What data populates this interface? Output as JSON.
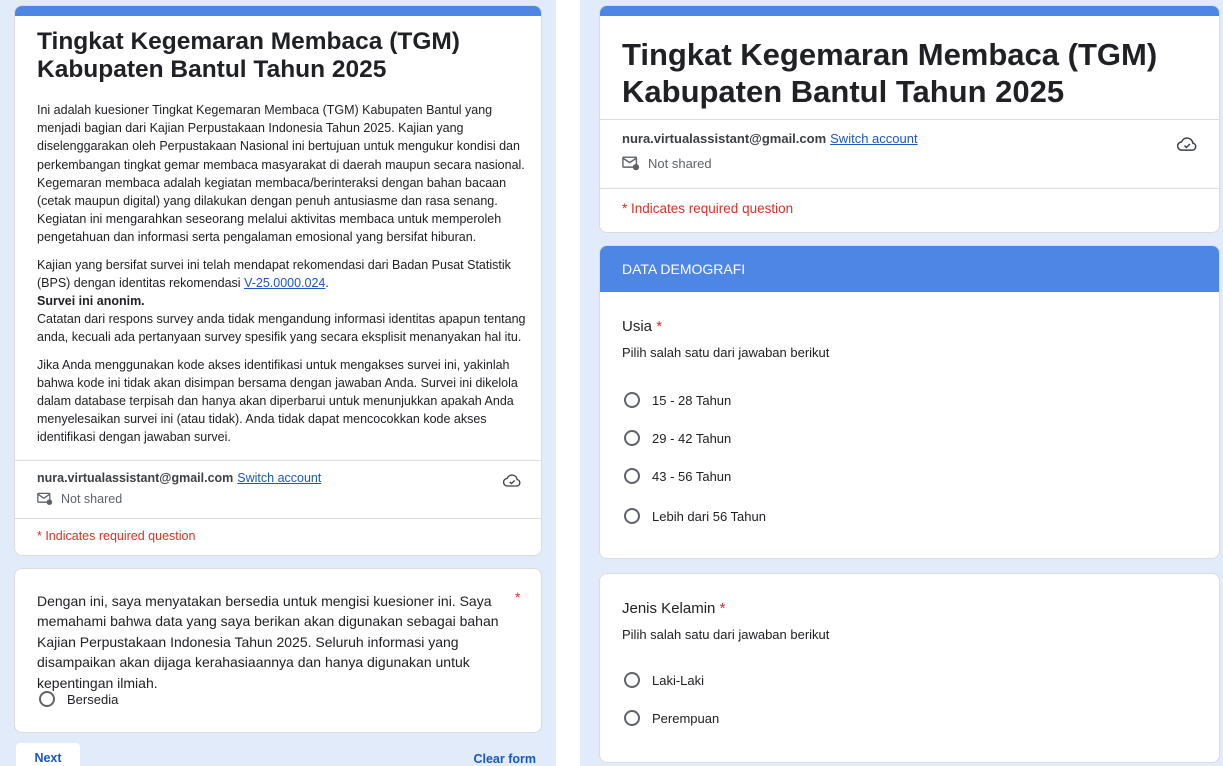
{
  "form": {
    "title_line1": "Tingkat Kegemaran Membaca (TGM)",
    "title_line2": "Kabupaten Bantul Tahun 2025",
    "description": {
      "p1_a": "Ini adalah kuesioner Tingkat Kegemaran Membaca (TGM) Kabupaten Bantul yang menjadi bagian dari Kajian Perpustakaan Indonesia Tahun 2025. Kajian yang diselenggarakan oleh Perpustakaan Nasional ini bertujuan untuk mengukur kondisi dan perkembangan tingkat gemar membaca masyarakat di daerah maupun secara nasional.",
      "p1_b": "Kegemaran membaca adalah kegiatan membaca/berinteraksi dengan bahan bacaan (cetak maupun digital) yang dilakukan dengan penuh antusiasme dan rasa senang. Kegiatan ini mengarahkan seseorang melalui aktivitas membaca untuk memperoleh pengetahuan dan informasi serta pengalaman emosional yang bersifat hiburan.",
      "p2_a": "Kajian yang bersifat survei  ini telah mendapat rekomendasi dari Badan Pusat Statistik (BPS) dengan identitas rekomendasi ",
      "p2_link": "V-25.0000.024",
      "p2_end": ".",
      "p2_bold": "Survei ini anonim.",
      "p2_c": "Catatan dari respons survey anda tidak mengandung informasi identitas apapun tentang anda, kecuali ada pertanyaan survey spesifik yang secara eksplisit menanyakan hal itu.",
      "p3": "Jika Anda menggunakan kode akses identifikasi untuk mengakses survei ini, yakinlah bahwa kode ini tidak akan disimpan bersama dengan jawaban Anda. Survei ini dikelola dalam database terpisah dan hanya akan diperbarui untuk menunjukkan apakah Anda menyelesaikan survei ini (atau tidak). Anda tidak dapat mencocokkan kode akses identifikasi dengan jawaban survei."
    },
    "account_email": "nura.virtualassistant@gmail.com",
    "switch_account": "Switch account",
    "not_shared": "Not shared",
    "required_note": "* Indicates required question"
  },
  "consent": {
    "text": "Dengan ini, saya menyatakan bersedia untuk mengisi kuesioner ini. Saya memahami bahwa data yang saya berikan akan digunakan sebagai bahan Kajian Perpustakaan Indonesia Tahun 2025. Seluruh informasi yang disampaikan akan dijaga kerahasiaannya dan hanya digunakan untuk kepentingan ilmiah.",
    "star": "*",
    "option": "Bersedia"
  },
  "nav": {
    "next": "Next",
    "clear": "Clear form"
  },
  "section": {
    "title": "DATA DEMOGRAFI"
  },
  "questions": {
    "usia": {
      "label": "Usia",
      "star": "*",
      "help": "Pilih salah satu dari jawaban berikut",
      "options": [
        "15 - 28 Tahun",
        "29 - 42 Tahun",
        "43 - 56 Tahun",
        "Lebih dari 56 Tahun"
      ]
    },
    "gender": {
      "label": "Jenis Kelamin",
      "star": "*",
      "help": "Pilih salah satu dari jawaban berikut",
      "options": [
        "Laki-Laki",
        "Perempuan"
      ]
    }
  },
  "colors": {
    "accent": "#4e86e6",
    "background": "#e1ebfa",
    "required": "#d93025",
    "link": "#1a56c5"
  }
}
